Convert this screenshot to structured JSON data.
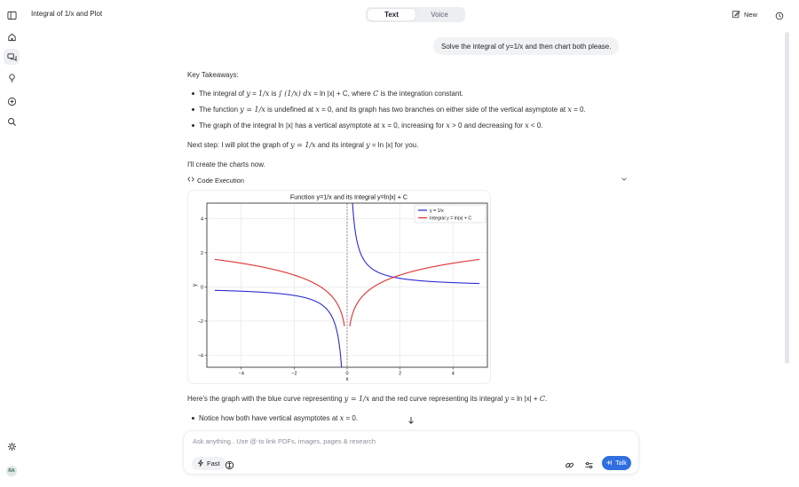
{
  "header": {
    "title": "Integral of 1/x and Plot",
    "tabs": [
      {
        "label": "Text",
        "active": true
      },
      {
        "label": "Voice",
        "active": false
      }
    ],
    "new_label": "New"
  },
  "sidebar": {
    "items": [
      {
        "icon": "sidebar-toggle-icon"
      },
      {
        "icon": "home-icon"
      },
      {
        "icon": "chats-icon",
        "active": true
      },
      {
        "icon": "lightbulb-icon"
      },
      {
        "icon": "add-circle-icon"
      },
      {
        "icon": "search-icon"
      }
    ],
    "settings_icon": "gear-icon",
    "avatar_initials": "RA"
  },
  "user_message": "Solve the integral of y=1/x and then chart both please.",
  "response": {
    "heading": "Key Takeaways:",
    "bullet1": {
      "a": "The integral of ",
      "b": "y",
      "c": " = ",
      "d": "1/x",
      "e": " is ",
      "f": "∫ (1/x) dx",
      "g": " = ln |x| + C",
      "h": ", where ",
      "i": "C",
      "j": " is the integration constant."
    },
    "bullet2": {
      "a": "The function ",
      "b": "y = 1/x",
      "c": " is undefined at ",
      "d": "x",
      "e": " = 0, and its graph has two branches on either side of the vertical asymptote at ",
      "f": "x",
      "g": " = 0."
    },
    "bullet3": {
      "a": "The graph of the integral ln |x| has a vertical asymptote at ",
      "b": "x",
      "c": " = 0, increasing for ",
      "d": "x",
      "e": " > 0 and decreasing for ",
      "f": "x",
      "g": " < 0."
    },
    "next_step": {
      "a": "Next step: I will plot the graph of ",
      "b": "y = 1/x",
      "c": " and its integral ",
      "d": "y",
      "e": " = ln |x| for you."
    },
    "create_line": "I'll create the charts now.",
    "code_execution_label": "Code Execution",
    "after_chart": {
      "a": "Here's the graph with the blue curve representing ",
      "b": "y = 1/x",
      "c": " and the red curve representing its integral ",
      "d": "y",
      "e": " = ln |x| + ",
      "f": "C",
      "g": "."
    },
    "bullet4": {
      "a": "Notice how both have vertical asymptotes at ",
      "b": "x",
      "c": " = 0."
    }
  },
  "composer": {
    "placeholder": "Ask anything.. Use @ to link PDFs, images, pages & research",
    "fast_label": "Fast",
    "talk_label": "Talk"
  },
  "colors": {
    "accent": "#2f6fe0",
    "series_blue": "#2b2bd4",
    "series_red": "#e03030"
  },
  "chart_data": {
    "type": "line",
    "title": "Function y=1/x and its Integral y=ln|x| + C",
    "xlabel": "x",
    "ylabel": "y",
    "xlim": [
      -5.3,
      5.3
    ],
    "ylim": [
      -4.7,
      4.9
    ],
    "xticks": [
      -4,
      -2,
      0,
      2,
      4
    ],
    "yticks": [
      -4,
      -2,
      0,
      2,
      4
    ],
    "vline_x": 0,
    "legend_position": "top-right",
    "grid": true,
    "series": [
      {
        "name": "y = 1/x",
        "color": "#2b2bd4",
        "function": "1/x"
      },
      {
        "name": "Integral y = ln|x| + C",
        "color": "#e03030",
        "function": "ln|x|"
      }
    ],
    "x_domain": [
      -5,
      5
    ],
    "x_gap": 0.1
  }
}
